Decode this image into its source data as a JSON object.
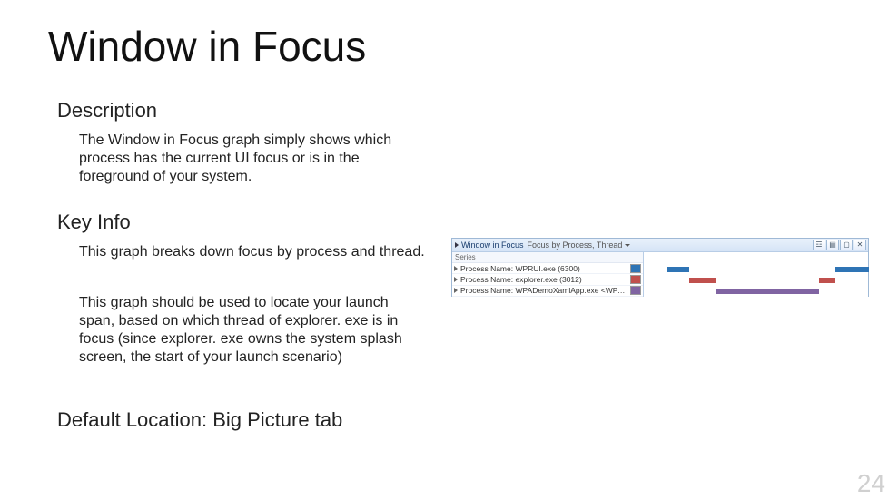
{
  "title": "Window in Focus",
  "description_heading": "Description",
  "description_body": "The Window in Focus graph simply shows which process has the current UI focus or is in the foreground of your system.",
  "keyinfo_heading": "Key Info",
  "keyinfo_p1": "This graph breaks down focus by process and thread.",
  "keyinfo_p2": "This graph should be used to locate your launch span, based on which thread of explorer. exe is in focus (since explorer. exe owns the system splash screen, the start of your launch scenario)",
  "default_location": "Default Location: Big Picture tab",
  "page_number": "24",
  "panel": {
    "window_label": "Window in Focus",
    "sub_label": "Focus by Process, Thread",
    "series_label": "Series",
    "rows": [
      {
        "label": "Process Name: WPRUI.exe (6300)",
        "color": "#2e74b5"
      },
      {
        "label": "Process Name: explorer.exe (3012)",
        "color": "#c0504d"
      },
      {
        "label": "Process Name: WPADemoXamlApp.exe <WPA...",
        "color": "#8064a2"
      }
    ],
    "icons": {
      "toggle": "☲",
      "chart": "▤",
      "maximize": "▢",
      "close": "✕"
    }
  },
  "chart_data": {
    "type": "bar",
    "xlim": [
      0,
      100
    ],
    "series": [
      {
        "name": "WPRUI.exe (6300)",
        "color": "#2e74b5",
        "segments": [
          {
            "start": 10,
            "end": 20
          },
          {
            "start": 85,
            "end": 100
          }
        ]
      },
      {
        "name": "explorer.exe (3012)",
        "color": "#c0504d",
        "segments": [
          {
            "start": 20,
            "end": 32
          },
          {
            "start": 78,
            "end": 85
          }
        ]
      },
      {
        "name": "WPADemoXamlApp.exe",
        "color": "#8064a2",
        "segments": [
          {
            "start": 32,
            "end": 78
          }
        ]
      }
    ]
  }
}
